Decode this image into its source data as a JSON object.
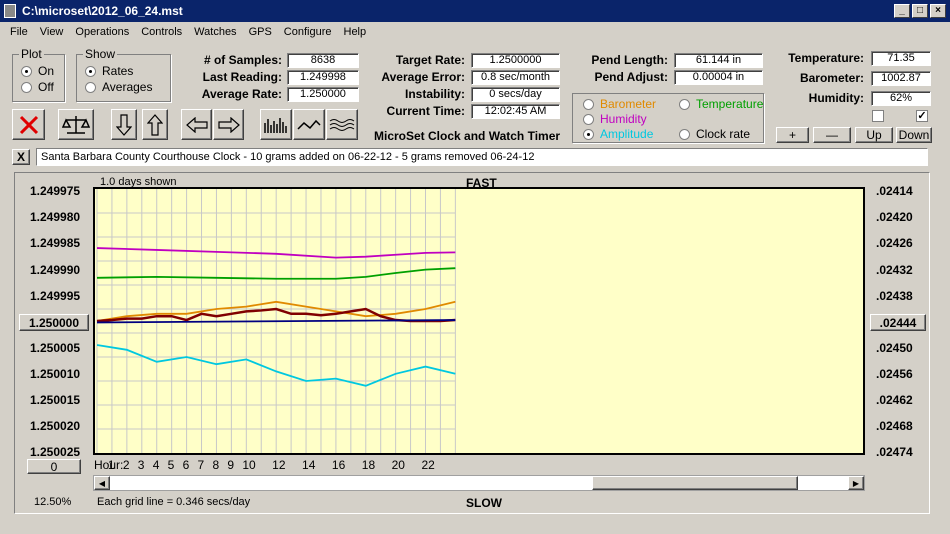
{
  "window": {
    "title": "C:\\microset\\2012_06_24.mst"
  },
  "menu": [
    "File",
    "View",
    "Operations",
    "Controls",
    "Watches",
    "GPS",
    "Configure",
    "Help"
  ],
  "plot": {
    "title": "Plot",
    "on": "On",
    "off": "Off"
  },
  "show": {
    "title": "Show",
    "rates": "Rates",
    "averages": "Averages"
  },
  "stats": {
    "samples_label": "# of Samples:",
    "samples": "8638",
    "last_label": "Last Reading:",
    "last": "1.249998",
    "avg_label": "Average Rate:",
    "avg": "1.250000",
    "target_label": "Target Rate:",
    "target": "1.2500000",
    "error_label": "Average Error:",
    "error": "0.8 sec/month",
    "instab_label": "Instability:",
    "instab": "0 secs/day",
    "time_label": "Current Time:",
    "time": "12:02:45 AM",
    "pendlen_label": "Pend Length:",
    "pendlen": "61.144 in",
    "pendadj_label": "Pend Adjust:",
    "pendadj": "0.00004 in",
    "temp_label": "Temperature:",
    "temp": "71.35",
    "baro_label": "Barometer:",
    "baro": "1002.87",
    "hum_label": "Humidity:",
    "hum": "62%"
  },
  "timer_title": "MicroSet Clock and Watch Timer",
  "sensor": {
    "barometer": "Barometer",
    "temperature": "Temperature",
    "humidity": "Humidity",
    "amplitude": "Amplitude",
    "clockrate": "Clock rate"
  },
  "colors": {
    "barometer": "#e08a00",
    "temperature": "#00a000",
    "humidity": "#c000c0",
    "amplitude": "#00c8e0",
    "rate": "#800000",
    "avg": "#000080",
    "plotbg": "#ffffc8"
  },
  "adj_buttons": {
    "plus": "+",
    "minus": "—",
    "up": "Up",
    "down": "Down"
  },
  "close_x": "X",
  "note": "Santa Barbara County Courthouse Clock - 10 grams added on 06-22-12 - 5 grams removed 06-24-12",
  "chart": {
    "days": "1.0 days shown",
    "fast": "FAST",
    "slow": "SLOW",
    "center_left": "1.250000",
    "center_right": ".02444",
    "zero_btn": "0",
    "zoom": "12.50%",
    "gridnote": "Each grid line = 0.346 secs/day",
    "hour_label": "Hour:"
  },
  "chart_data": {
    "type": "line",
    "left_ticks": [
      "1.249975",
      "1.249980",
      "1.249985",
      "1.249990",
      "1.249995",
      "1.250005",
      "1.250010",
      "1.250015",
      "1.250020",
      "1.250025"
    ],
    "right_ticks": [
      ".02414",
      ".02420",
      ".02426",
      ".02432",
      ".02438",
      ".02450",
      ".02456",
      ".02462",
      ".02468",
      ".02474"
    ],
    "hours": [
      "1",
      "2",
      "3",
      "4",
      "5",
      "6",
      "7",
      "8",
      "9",
      "10",
      "12",
      "14",
      "16",
      "18",
      "20",
      "22"
    ],
    "title": "FAST",
    "series": [
      {
        "name": "Humidity",
        "key": "humidity",
        "x": [
          0,
          4,
          8,
          12,
          16,
          18,
          20,
          22,
          24
        ],
        "y": [
          1.2499848,
          1.2499852,
          1.2499856,
          1.249986,
          1.2499868,
          1.2499866,
          1.2499862,
          1.2499858,
          1.2499857
        ]
      },
      {
        "name": "Temperature",
        "key": "temperature",
        "x": [
          0,
          4,
          8,
          12,
          16,
          18,
          20,
          22,
          24
        ],
        "y": [
          1.249991,
          1.2499908,
          1.249991,
          1.2499912,
          1.2499912,
          1.2499908,
          1.24999,
          1.2499893,
          1.249989
        ]
      },
      {
        "name": "Barometer",
        "key": "barometer",
        "x": [
          0,
          2,
          4,
          6,
          8,
          10,
          12,
          14,
          16,
          18,
          20,
          22,
          24
        ],
        "y": [
          1.25,
          1.249999,
          1.2499985,
          1.2499985,
          1.2499975,
          1.249997,
          1.249996,
          1.249997,
          1.249998,
          1.249999,
          1.2499985,
          1.2499975,
          1.249996
        ]
      },
      {
        "name": "Amplitude",
        "key": "amplitude",
        "x": [
          0,
          2,
          4,
          6,
          8,
          10,
          12,
          14,
          16,
          18,
          20,
          22,
          24
        ],
        "y": [
          1.250005,
          1.250006,
          1.2500085,
          1.2500075,
          1.250009,
          1.250008,
          1.2500105,
          1.2500125,
          1.250012,
          1.2500135,
          1.250011,
          1.2500095,
          1.250011
        ]
      },
      {
        "name": "Clock rate",
        "key": "rate",
        "x": [
          0,
          1,
          2,
          3,
          4,
          5,
          6,
          7,
          8,
          9,
          10,
          11,
          12,
          13,
          14,
          15,
          16,
          17,
          18,
          19,
          20,
          21,
          22,
          23,
          24
        ],
        "y": [
          1.25,
          1.2499998,
          1.2499995,
          1.2499995,
          1.249999,
          1.249999,
          1.2499998,
          1.2499985,
          1.249999,
          1.2499985,
          1.249998,
          1.2499978,
          1.2499975,
          1.2499985,
          1.2499985,
          1.2499988,
          1.2499985,
          1.249998,
          1.2499975,
          1.249999,
          1.2499998,
          1.25,
          1.25,
          1.25,
          1.2499998
        ]
      },
      {
        "name": "Average",
        "key": "avg",
        "x": [
          0,
          24
        ],
        "y": [
          1.2500003,
          1.2499998
        ]
      }
    ],
    "ylim": [
      1.2499725,
      1.2500275
    ],
    "xlim": [
      0,
      51.3
    ]
  }
}
